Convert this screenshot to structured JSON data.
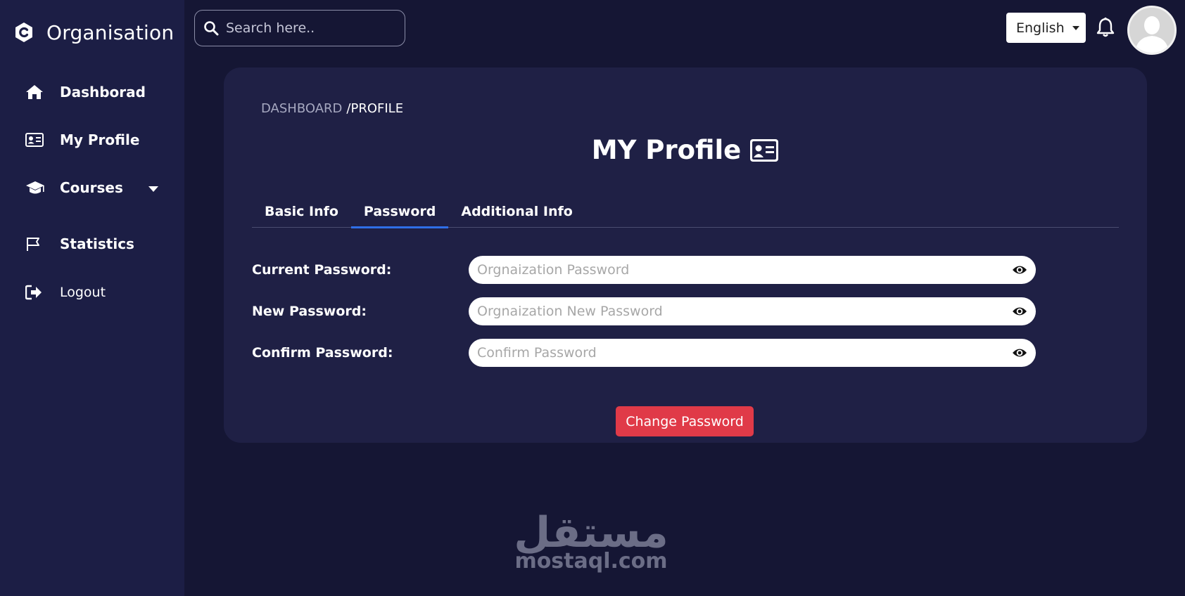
{
  "brand": {
    "name": "Organisation",
    "logo_icon": "c-logo-icon"
  },
  "sidebar": {
    "items": [
      {
        "label": "Dashborad",
        "icon": "home-icon"
      },
      {
        "label": "My Profile",
        "icon": "id-card-icon"
      },
      {
        "label": "Courses",
        "icon": "graduation-cap-icon",
        "has_dropdown": true
      },
      {
        "label": "Statistics",
        "icon": "flag-icon"
      },
      {
        "label": "Logout",
        "icon": "logout-icon"
      }
    ]
  },
  "header": {
    "search_placeholder": "Search here..",
    "language": "English"
  },
  "breadcrumb": {
    "root": "DASHBOARD",
    "separator": "/",
    "current": "PROFILE"
  },
  "page": {
    "title": "MY Profile"
  },
  "tabs": [
    {
      "label": "Basic Info",
      "active": false
    },
    {
      "label": "Password",
      "active": true
    },
    {
      "label": "Additional Info",
      "active": false
    }
  ],
  "form": {
    "fields": [
      {
        "label": "Current Password:",
        "placeholder": "Orgnaization Password",
        "value": ""
      },
      {
        "label": "New Password:",
        "placeholder": "Orgnaization New Password",
        "value": ""
      },
      {
        "label": "Confirm Password:",
        "placeholder": "Confirm Password",
        "value": ""
      }
    ],
    "submit_label": "Change Password"
  },
  "watermark": {
    "arabic": "مستقل",
    "latin": "mostaql.com"
  },
  "colors": {
    "background": "#151634",
    "sidebar": "#1c1e45",
    "card": "#1f2045",
    "accent_tab": "#2f6fe8",
    "button": "#e03a48"
  }
}
